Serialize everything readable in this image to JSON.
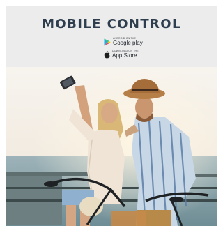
{
  "header": {
    "title": "MOBILE CONTROL"
  },
  "badges": {
    "google_play": {
      "caption": "Android on the",
      "store": "Google play",
      "icon": "google-play-icon"
    },
    "app_store": {
      "caption": "Download on the",
      "store": "App Store",
      "icon": "apple-icon"
    }
  },
  "colors": {
    "header_bg": "#ececed",
    "title": "#2e3e4e"
  }
}
